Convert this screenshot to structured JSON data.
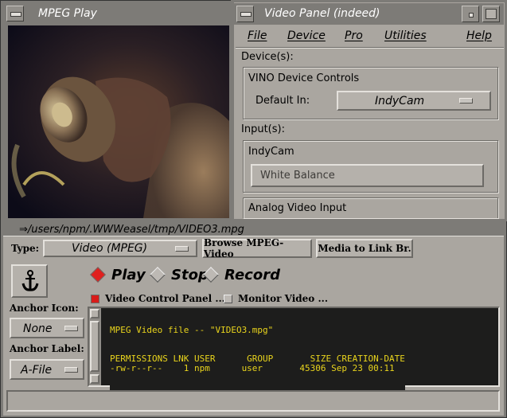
{
  "mpeg_window": {
    "title": "MPEG Play",
    "path": "⇒/users/npm/.WWWeasel/tmp/VIDEO3.mpg",
    "type_label": "Type:",
    "type_value": "Video (MPEG)",
    "browse_button": "Browse MPEG-Video",
    "media_button": "Media to Link Br.",
    "anchor_icon_label": "Anchor Icon:",
    "anchor_icon_value": "None",
    "anchor_label_label": "Anchor Label:",
    "anchor_label_value": "A-File",
    "play_label": "Play",
    "stop_label": "Stop",
    "record_label": "Record",
    "video_control_check": "Video Control Panel ...",
    "monitor_video_check": "Monitor Video ...",
    "terminal_lines": [
      "MPEG Video file -- \"VIDEO3.mpg\"",
      "",
      "PERMISSIONS LNK USER      GROUP       SIZE CREATION-DATE",
      "-rw-r--r--    1 npm      user       45306 Sep 23 00:11"
    ]
  },
  "video_panel": {
    "title": "Video Panel (indeed)",
    "menu": [
      "File",
      "Device",
      "Pro",
      "Utilities",
      "Help"
    ],
    "devices_label": "Device(s):",
    "vino_group": "VINO Device Controls",
    "default_in_label": "Default In:",
    "default_in_value": "IndyCam",
    "inputs_label": "Input(s):",
    "indycam_group": "IndyCam",
    "white_balance": "White Balance",
    "analog_group": "Analog Video Input"
  },
  "colors": {
    "background": "#aaa6a0",
    "terminal_bg": "#1d1d1c",
    "terminal_fg": "#e9d41c",
    "radio_selected": "#e0201e",
    "checkbox_selected": "#d81c1a"
  },
  "icons": {
    "anchor": "anchor-icon",
    "window_menu": "window-menu-icon",
    "minimize": "minimize-icon"
  }
}
